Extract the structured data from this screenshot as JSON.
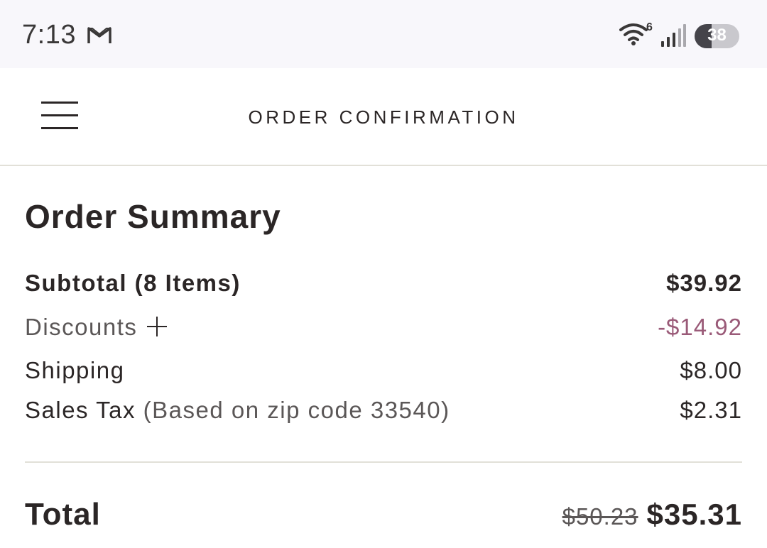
{
  "status_bar": {
    "time": "7:13",
    "notification_icon": "gmail-icon",
    "wifi_icon": "wifi-icon",
    "wifi_badge": "6",
    "signal_icon": "signal-icon",
    "battery_level": "38",
    "battery_fraction": 0.38
  },
  "header": {
    "menu_icon": "hamburger-menu-icon",
    "title": "ORDER CONFIRMATION"
  },
  "summary": {
    "heading": "Order Summary",
    "lines": [
      {
        "label": "Subtotal (8 Items)",
        "value": "$39.92"
      },
      {
        "label": "Discounts",
        "value": "-$14.92",
        "icon": "plus-icon"
      },
      {
        "label": "Shipping",
        "value": "$8.00"
      },
      {
        "label": "Sales Tax",
        "note": "(Based on zip code 33540)",
        "value": "$2.31"
      }
    ],
    "total": {
      "label": "Total",
      "original": "$50.23",
      "final": "$35.31"
    }
  },
  "colors": {
    "text": "#2b2626",
    "muted_text": "#5b5757",
    "discount": "#9a5a78",
    "divider": "#e2e0d8",
    "status_bar_bg": "#f8f7fb"
  }
}
